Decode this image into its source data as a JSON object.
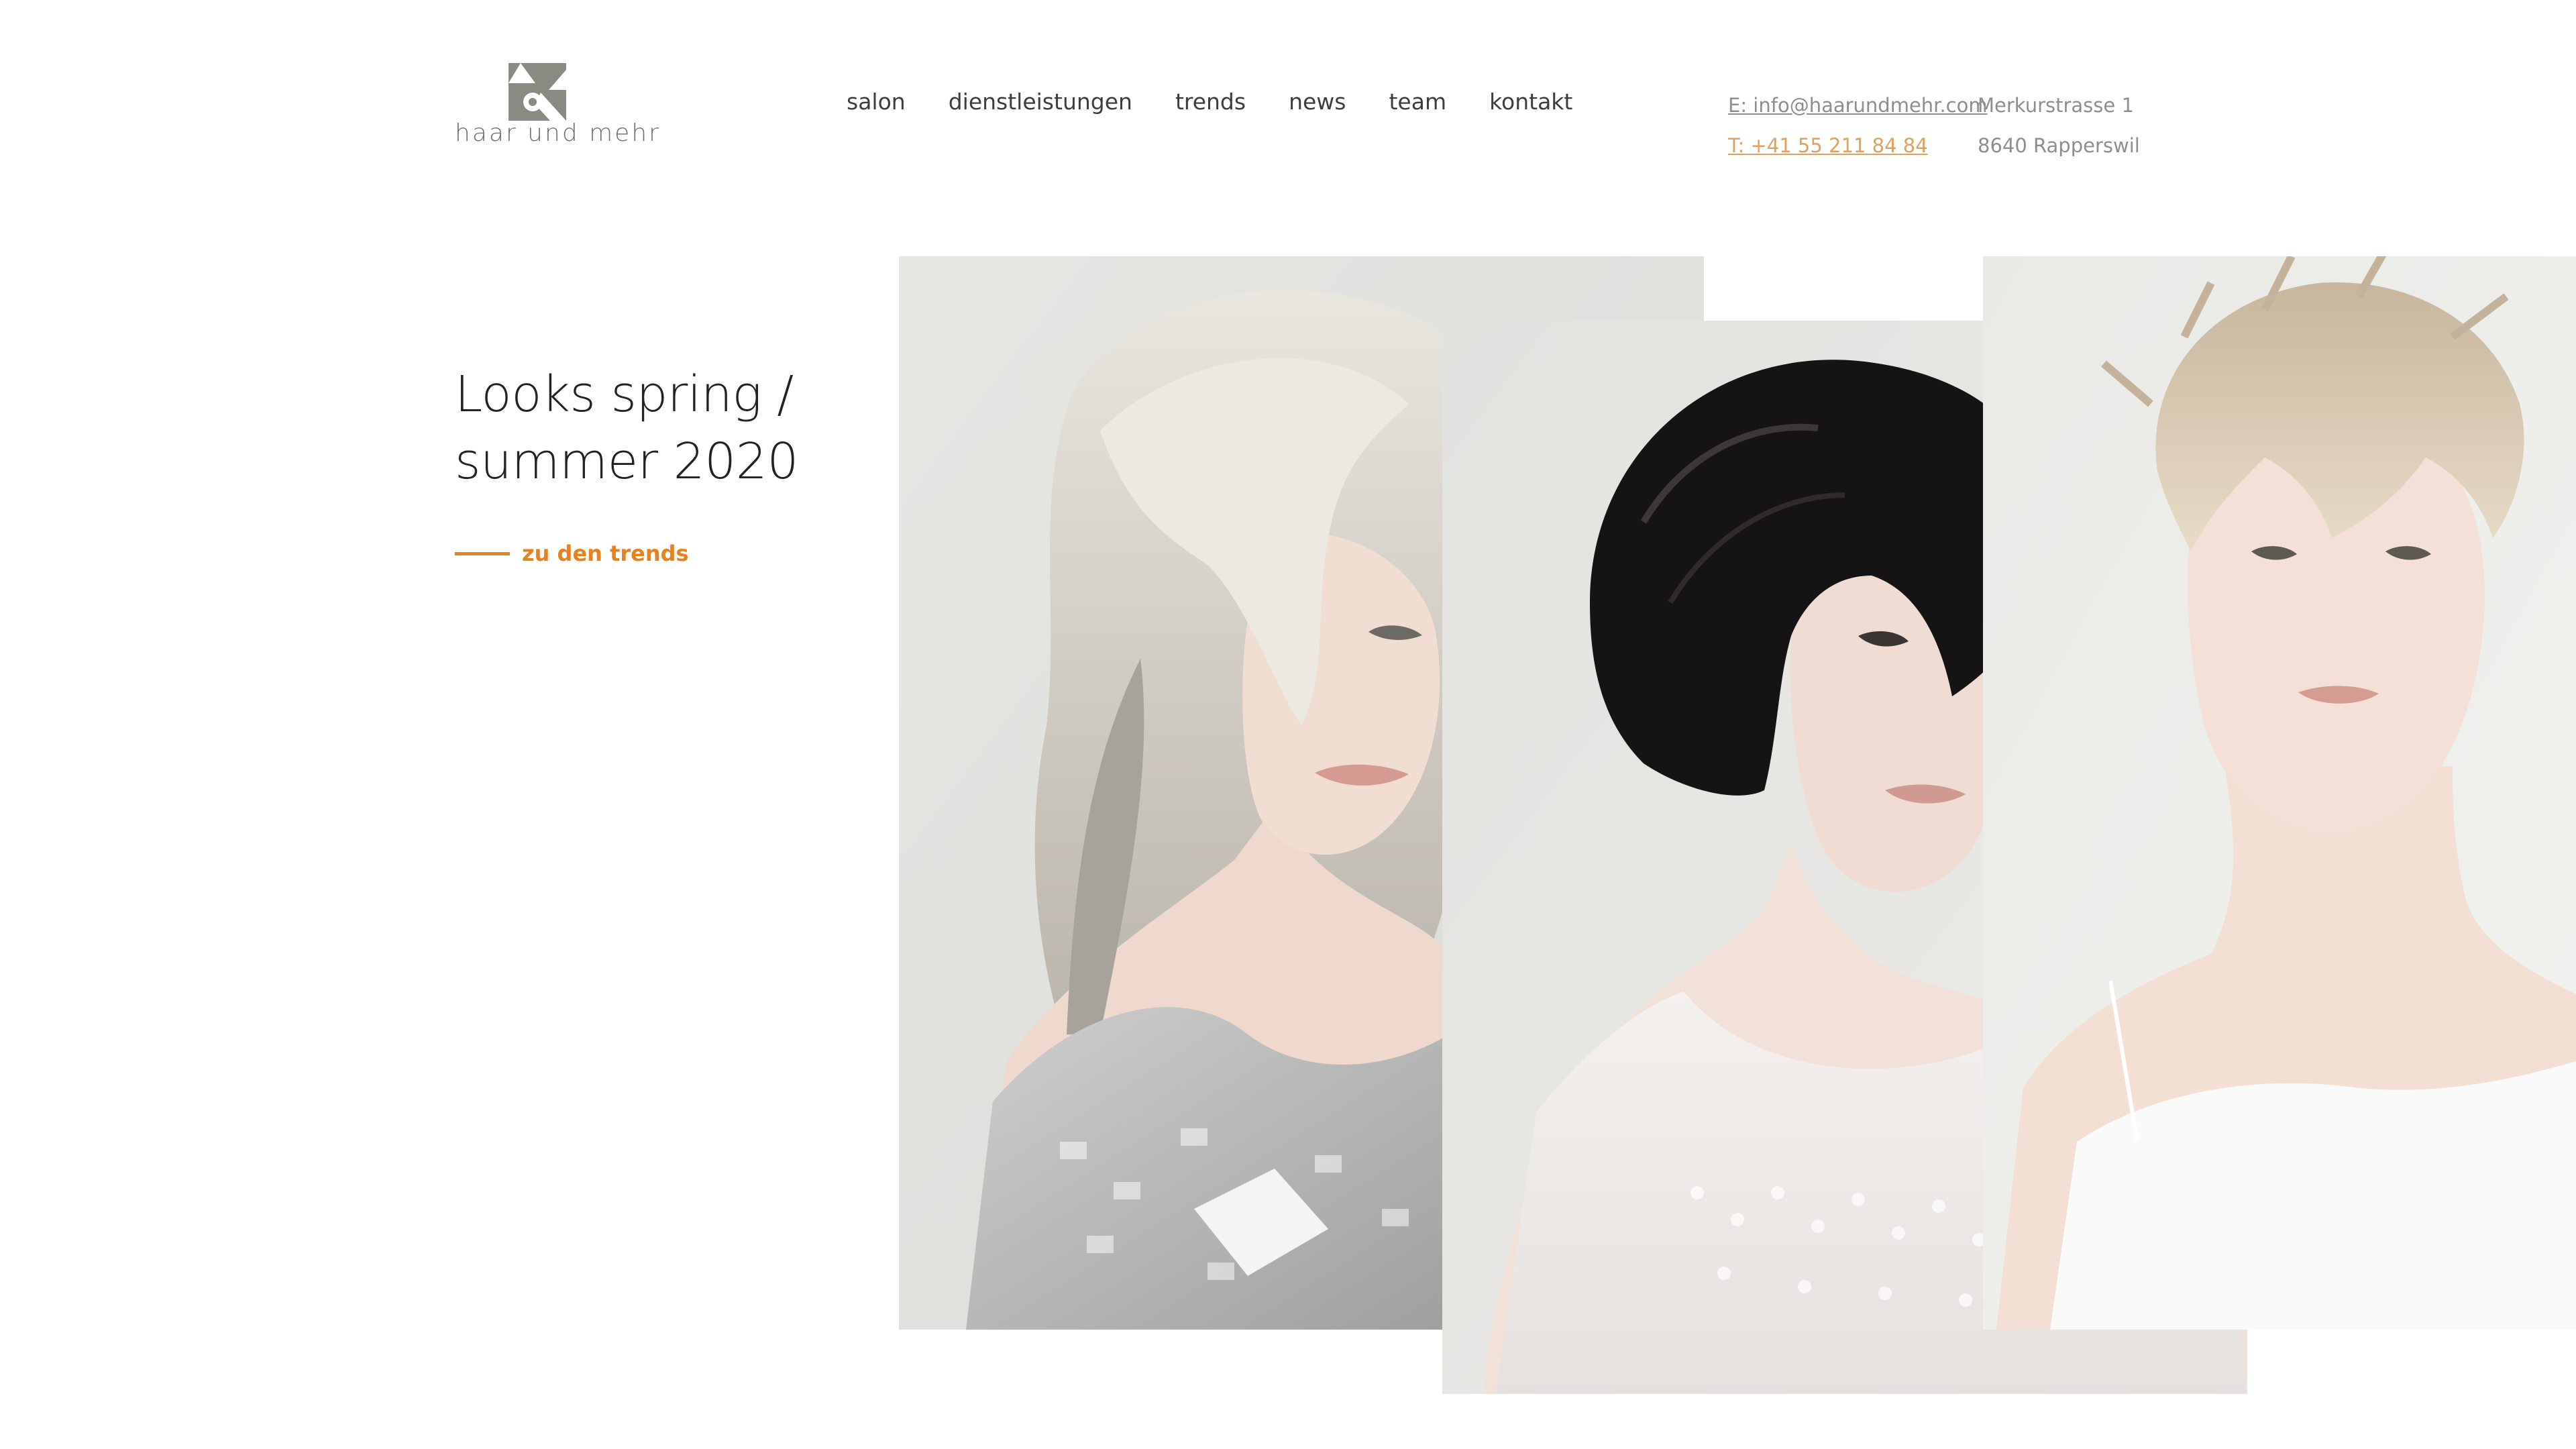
{
  "brand": {
    "logo_name": "haar und mehr",
    "logo_icon": "ampersand-icon",
    "accent_color": "#e8821e",
    "logo_color": "#8a8a82"
  },
  "nav": {
    "items": [
      {
        "label": "salon"
      },
      {
        "label": "dienstleistungen"
      },
      {
        "label": "trends"
      },
      {
        "label": "news"
      },
      {
        "label": "team"
      },
      {
        "label": "kontakt"
      }
    ]
  },
  "contact": {
    "email": "E: info@haarundmehr.com",
    "phone": "T: +41 55 211 84 84",
    "street": "Merkurstrasse 1",
    "city": "8640 Rapperswil"
  },
  "hero": {
    "title_line1": "Looks spring /",
    "title_line2": "summer 2020",
    "cta_label": "zu den trends"
  },
  "gallery": {
    "photos": [
      {
        "subject": "model with long platinum blonde layered hair"
      },
      {
        "subject": "model with short black bob"
      },
      {
        "subject": "model with short blonde pixie cut"
      }
    ]
  }
}
